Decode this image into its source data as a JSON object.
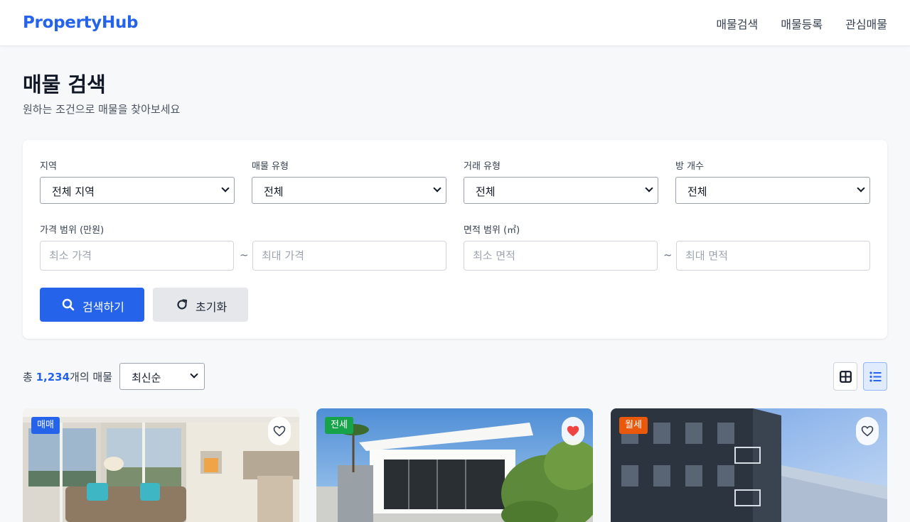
{
  "header": {
    "brand": "PropertyHub",
    "nav": [
      "매물검색",
      "매물등록",
      "관심매물"
    ]
  },
  "page": {
    "title": "매물 검색",
    "subtitle": "원하는 조건으로 매물을 찾아보세요"
  },
  "filters": {
    "region": {
      "label": "지역",
      "value": "전체 지역"
    },
    "property_type": {
      "label": "매물 유형",
      "value": "전체"
    },
    "deal_type": {
      "label": "거래 유형",
      "value": "전체"
    },
    "rooms": {
      "label": "방 개수",
      "value": "전체"
    },
    "price": {
      "label": "가격 범위 (만원)",
      "min_placeholder": "최소 가격",
      "max_placeholder": "최대 가격",
      "separator": "~"
    },
    "area": {
      "label": "면적 범위 (㎡)",
      "min_placeholder": "최소 면적",
      "max_placeholder": "최대 면적",
      "separator": "~"
    },
    "search_button": "검색하기",
    "reset_button": "초기화"
  },
  "results": {
    "prefix": "총 ",
    "count": "1,234",
    "suffix": "개의 매물",
    "sort_value": "최신순"
  },
  "listings": [
    {
      "badge": "매매",
      "badge_color": "#2563eb",
      "favorited": false
    },
    {
      "badge": "전세",
      "badge_color": "#16a34a",
      "favorited": true
    },
    {
      "badge": "월세",
      "badge_color": "#ea580c",
      "favorited": false
    }
  ],
  "colors": {
    "accent": "#2563eb",
    "heart": "#ef4444"
  }
}
